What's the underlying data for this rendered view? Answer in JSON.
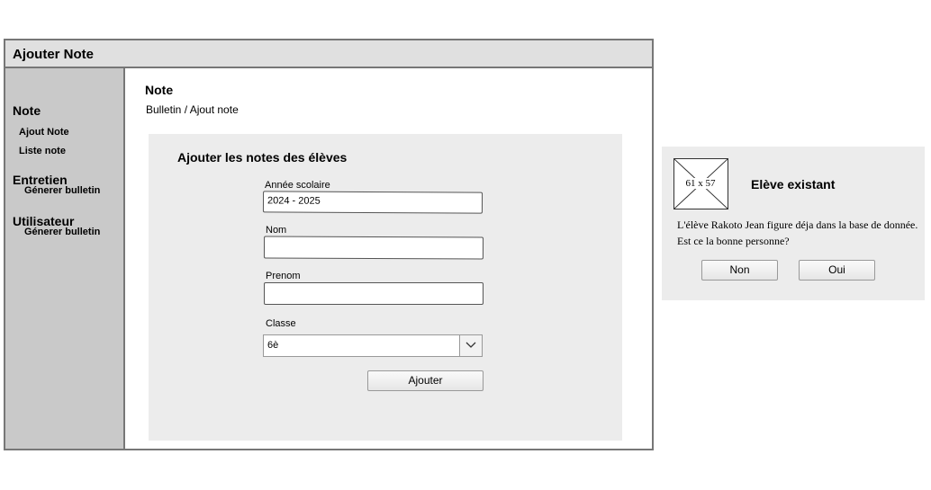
{
  "window": {
    "title": "Ajouter Note"
  },
  "sidebar": {
    "sections": [
      {
        "heading": "Note",
        "items": [
          "Ajout Note",
          "Liste note"
        ]
      },
      {
        "heading": "Entretien",
        "items": [
          "Génerer bulletin"
        ]
      },
      {
        "heading": "Utilisateur",
        "items": [
          "Génerer bulletin"
        ]
      }
    ]
  },
  "main": {
    "title": "Note",
    "breadcrumb": "Bulletin / Ajout note",
    "form": {
      "title": "Ajouter les notes des élèves",
      "annee_label": "Année scolaire",
      "annee_value": "2024 - 2025",
      "nom_label": "Nom",
      "nom_value": "",
      "prenom_label": "Prenom",
      "prenom_value": "",
      "classe_label": "Classe",
      "classe_value": "6è",
      "submit_label": "Ajouter"
    }
  },
  "dialog": {
    "image_placeholder": "61 x 57",
    "title": "Elève existant",
    "message_line1": "L'élève Rakoto Jean figure déja dans la base de donnée.",
    "message_line2": "Est ce la bonne personne?",
    "no_label": "Non",
    "yes_label": "Oui"
  },
  "icons": {
    "select_arrow": "chevron-down-icon",
    "image": "image-placeholder-icon"
  }
}
